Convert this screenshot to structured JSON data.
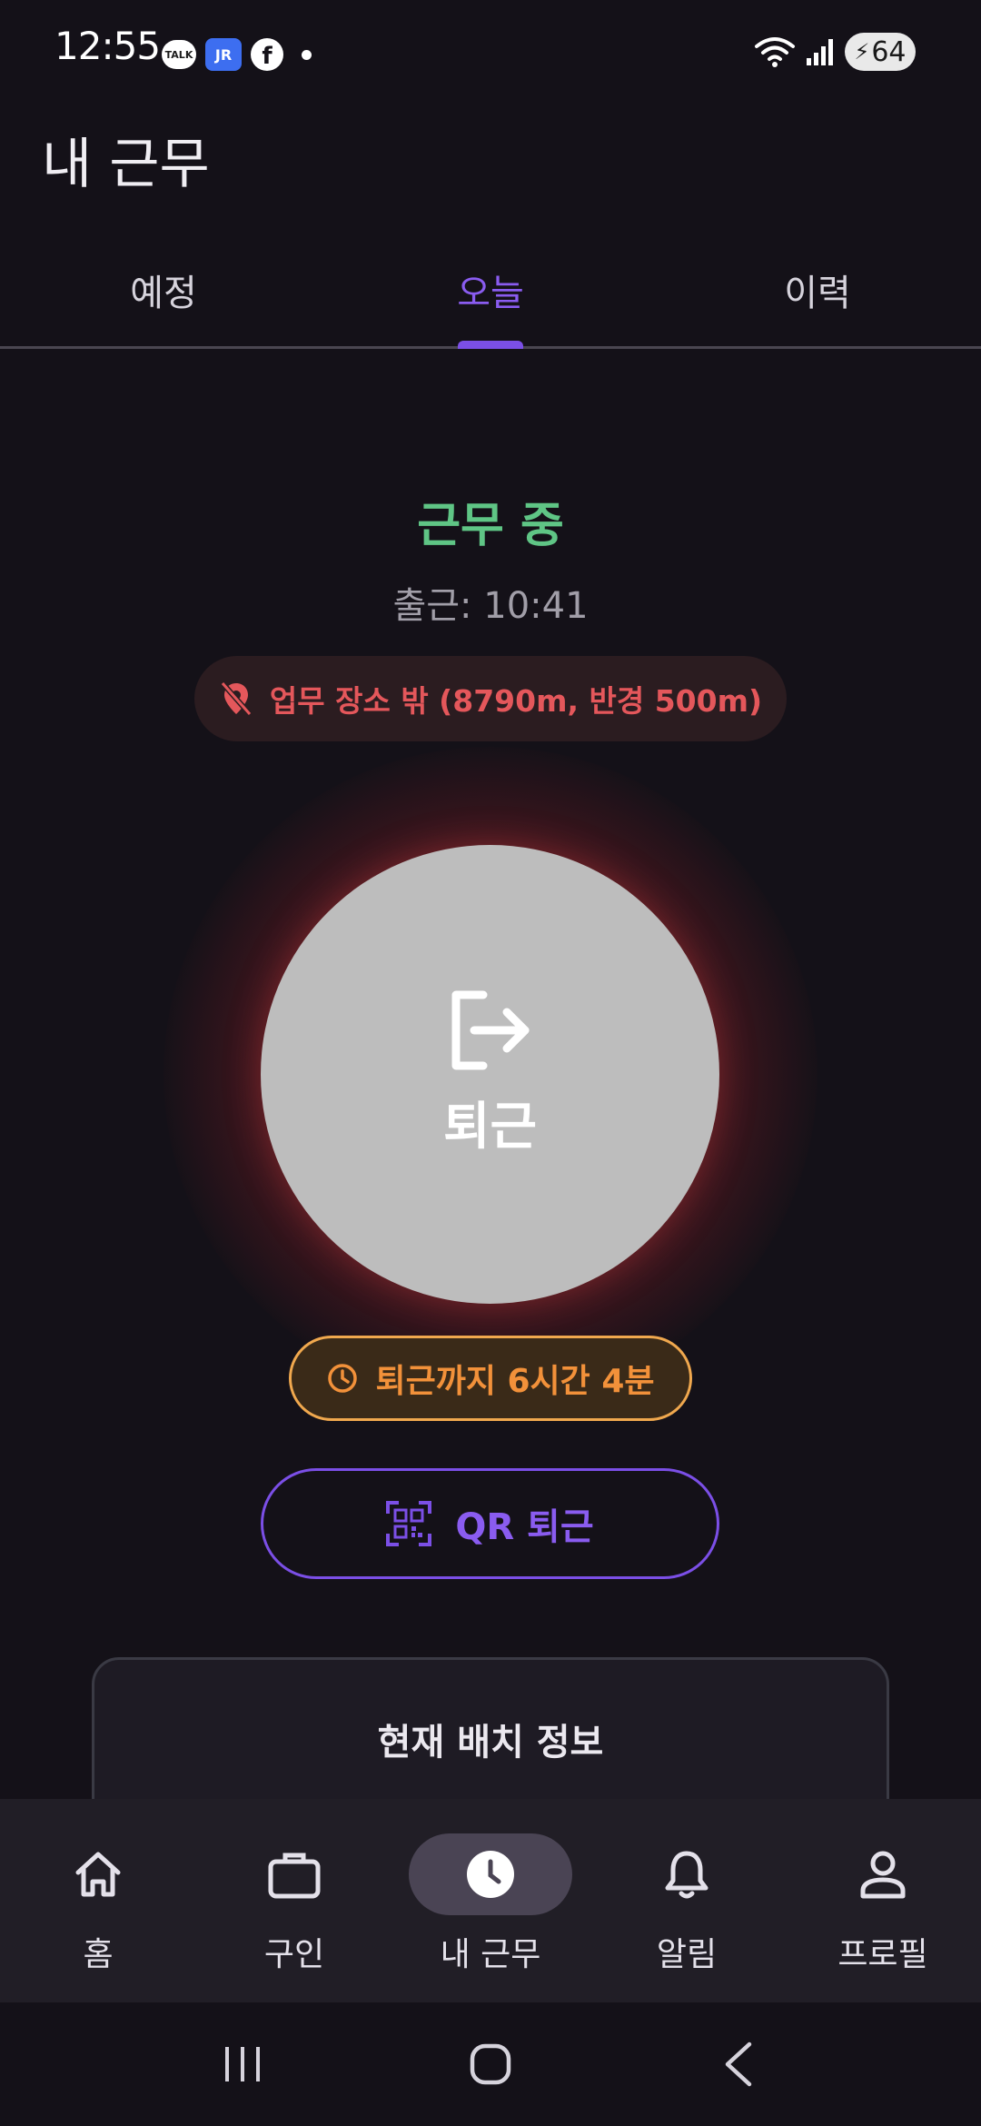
{
  "status_bar": {
    "time": "12:55",
    "talk_badge": "TALK",
    "jr_badge": "JR",
    "fb_badge": "f",
    "battery": "64"
  },
  "header": {
    "title": "내 근무"
  },
  "tabs": [
    {
      "label": "예정",
      "active": false
    },
    {
      "label": "오늘",
      "active": true
    },
    {
      "label": "이력",
      "active": false
    }
  ],
  "work": {
    "status": "근무 중",
    "clock_in": "출근: 10:41",
    "location_warning": "업무 장소 밖 (8790m, 반경 500m)",
    "checkout_label": "퇴근",
    "countdown": "퇴근까지 6시간 4분",
    "qr_checkout_label": "QR 퇴근"
  },
  "info_card": {
    "title": "현재 배치 정보"
  },
  "bottom_nav": [
    {
      "label": "홈",
      "icon": "home-icon",
      "active": false
    },
    {
      "label": "구인",
      "icon": "briefcase-icon",
      "active": false
    },
    {
      "label": "내 근무",
      "icon": "clock-icon",
      "active": true
    },
    {
      "label": "알림",
      "icon": "bell-icon",
      "active": false
    },
    {
      "label": "프로필",
      "icon": "person-icon",
      "active": false
    }
  ],
  "colors": {
    "accent": "#7b4fe6",
    "working_green": "#5fc585",
    "warning_red": "#e4575b",
    "countdown_orange": "#f2913a"
  }
}
